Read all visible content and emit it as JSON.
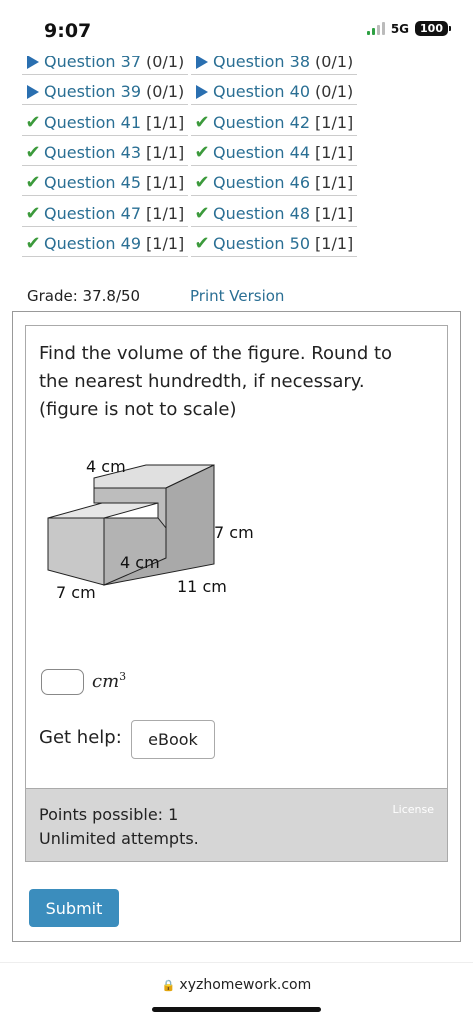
{
  "status_bar": {
    "time": "9:07",
    "network": "5G",
    "battery": "100"
  },
  "questions": [
    [
      {
        "label": "Question 37",
        "score": "(0/1)",
        "status": "unanswered"
      },
      {
        "label": "Question 38",
        "score": "(0/1)",
        "status": "unanswered"
      }
    ],
    [
      {
        "label": "Question 39",
        "score": "(0/1)",
        "status": "unanswered"
      },
      {
        "label": "Question 40",
        "score": "(0/1)",
        "status": "unanswered"
      }
    ],
    [
      {
        "label": "Question 41",
        "score": "[1/1]",
        "status": "correct"
      },
      {
        "label": "Question 42",
        "score": "[1/1]",
        "status": "correct"
      }
    ],
    [
      {
        "label": "Question 43",
        "score": "[1/1]",
        "status": "correct"
      },
      {
        "label": "Question 44",
        "score": "[1/1]",
        "status": "correct"
      }
    ],
    [
      {
        "label": "Question 45",
        "score": "[1/1]",
        "status": "correct"
      },
      {
        "label": "Question 46",
        "score": "[1/1]",
        "status": "correct"
      }
    ],
    [
      {
        "label": "Question 47",
        "score": "[1/1]",
        "status": "correct"
      },
      {
        "label": "Question 48",
        "score": "[1/1]",
        "status": "correct"
      }
    ],
    [
      {
        "label": "Question 49",
        "score": "[1/1]",
        "status": "correct"
      },
      {
        "label": "Question 50",
        "score": "[1/1]",
        "status": "correct"
      }
    ]
  ],
  "grade": "Grade: 37.8/50",
  "print_version": "Print Version",
  "question": {
    "prompt": "Find the volume of the figure. Round to the nearest hundredth, if necessary. (figure is not to scale)",
    "figure_labels": {
      "top": "4 cm",
      "right": "7 cm",
      "middle": "4 cm",
      "left_bottom": "7 cm",
      "bottom": "11 cm"
    },
    "answer_value": "",
    "unit": "cm",
    "unit_exponent": "3",
    "get_help": "Get help:",
    "ebook": "eBook"
  },
  "points": {
    "possible": "Points possible: 1",
    "attempts": "Unlimited attempts.",
    "license": "License"
  },
  "submit": "Submit",
  "url": "xyzhomework.com",
  "colors": {
    "link": "#2a6f94",
    "check": "#3c9a3c",
    "submit": "#3b8dbd",
    "points_bg": "#d6d6d6"
  }
}
